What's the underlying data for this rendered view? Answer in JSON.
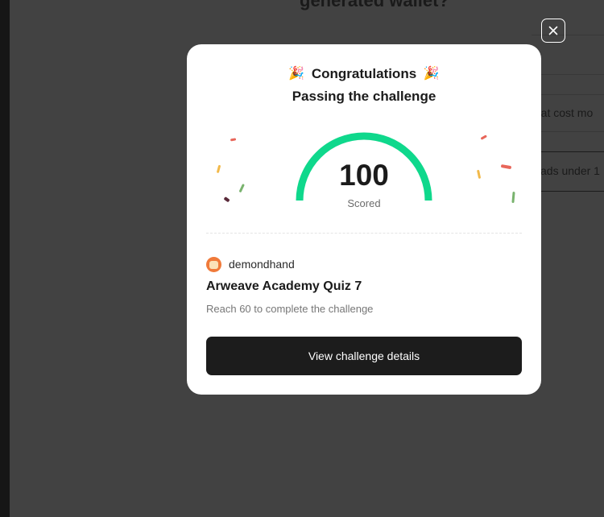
{
  "background": {
    "heading": "generated wallet?",
    "option_1": "that cost mo",
    "option_2": "ads under 1"
  },
  "modal": {
    "close_icon": "close-icon",
    "emoji_left": "🎉",
    "emoji_right": "🎉",
    "title": "Congratulations",
    "subtitle": "Passing the challenge",
    "score": "100",
    "score_label": "Scored",
    "gauge": {
      "value": 100,
      "max": 100,
      "color": "#0fd88c"
    },
    "author": {
      "name": "demondhand",
      "avatar_icon": "avatar-icon"
    },
    "quiz_title": "Arweave Academy Quiz 7",
    "requirement": "Reach 60 to complete the challenge",
    "cta_label": "View challenge details"
  },
  "colors": {
    "overlay": "#424242",
    "modal_bg": "#ffffff",
    "cta_bg": "#1c1c1c",
    "confetti": [
      "#e8665a",
      "#f2b94a",
      "#79b36e",
      "#5a2a3a"
    ]
  }
}
